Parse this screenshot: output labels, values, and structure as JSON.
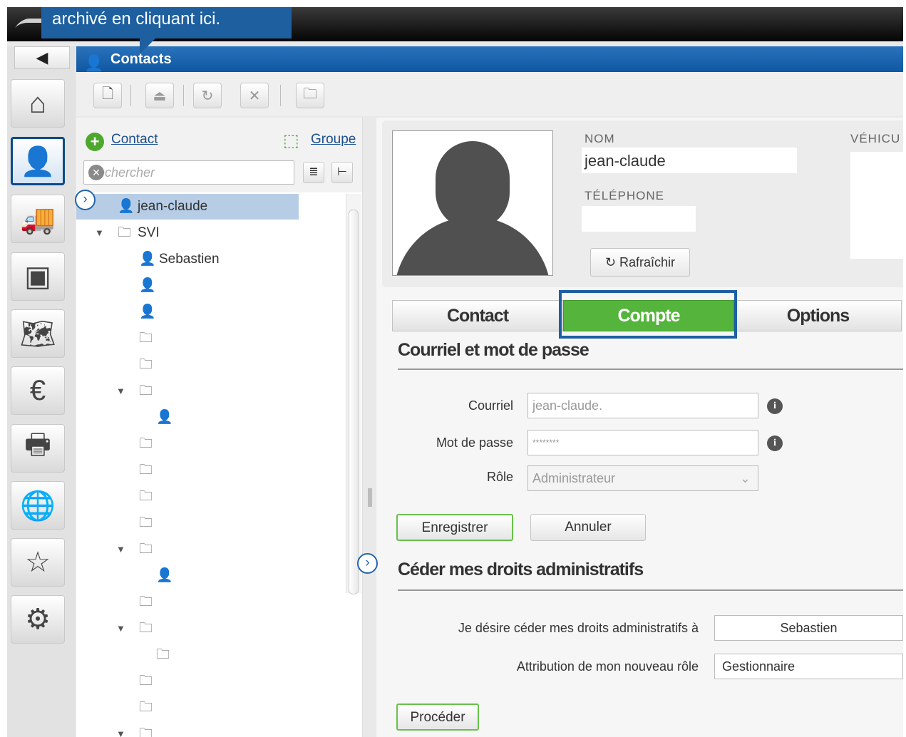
{
  "tooltip": "archivé en cliquant ici.",
  "header": {
    "title": "Contacts"
  },
  "colors": {
    "accent": "#0f57a2",
    "green": "#55b43c",
    "highlight": "#1c5fa3"
  },
  "nav_icons": [
    "home-icon",
    "contact-person-icon",
    "vehicles-icon",
    "device-icon",
    "map-icon",
    "billing-icon",
    "printer-icon",
    "globe-icon",
    "star-icon",
    "gear-icon"
  ],
  "left": {
    "add_contact": "Contact",
    "add_group": "Groupe",
    "search_placeholder": "Rechercher",
    "tree": [
      {
        "type": "person",
        "label": "jean-claude",
        "indent": 0,
        "selected": true,
        "expand": false
      },
      {
        "type": "folder",
        "label": "SVI",
        "indent": 0,
        "expand": true
      },
      {
        "type": "person",
        "label": "Sebastien",
        "indent": 1,
        "expand": false
      },
      {
        "type": "person",
        "label": "",
        "indent": 1,
        "expand": false
      },
      {
        "type": "person",
        "label": "",
        "indent": 1,
        "expand": false
      },
      {
        "type": "folder",
        "label": "",
        "indent": 1,
        "expand": false
      },
      {
        "type": "folder",
        "label": "",
        "indent": 1,
        "expand": false
      },
      {
        "type": "folder",
        "label": "",
        "indent": 1,
        "expand": true
      },
      {
        "type": "person",
        "label": "",
        "indent": 2,
        "expand": false
      },
      {
        "type": "folder",
        "label": "",
        "indent": 1,
        "expand": false
      },
      {
        "type": "folder",
        "label": "",
        "indent": 1,
        "expand": false
      },
      {
        "type": "folder",
        "label": "",
        "indent": 1,
        "expand": false
      },
      {
        "type": "folder",
        "label": "",
        "indent": 1,
        "expand": false
      },
      {
        "type": "folder",
        "label": "",
        "indent": 1,
        "expand": true
      },
      {
        "type": "person",
        "label": "",
        "indent": 2,
        "expand": false
      },
      {
        "type": "folder",
        "label": "",
        "indent": 1,
        "expand": false
      },
      {
        "type": "folder",
        "label": "",
        "indent": 1,
        "expand": true
      },
      {
        "type": "folder",
        "label": "",
        "indent": 2,
        "expand": false
      },
      {
        "type": "folder",
        "label": "",
        "indent": 1,
        "expand": false
      },
      {
        "type": "folder",
        "label": "",
        "indent": 1,
        "expand": false
      },
      {
        "type": "folder",
        "label": "",
        "indent": 1,
        "expand": true
      }
    ]
  },
  "profile": {
    "nom_label": "NOM",
    "nom_value": "jean-claude",
    "tel_label": "TÉLÉPHONE",
    "vehicule_label": "VÉHICU",
    "refresh": "Rafraîchir"
  },
  "tabs": [
    "Contact",
    "Compte",
    "Options"
  ],
  "account": {
    "section1": "Courriel et mot de passe",
    "email_label": "Courriel",
    "email_value": "jean-claude.",
    "password_label": "Mot de passe",
    "password_value": "********",
    "role_label": "Rôle",
    "role_value": "Administrateur",
    "save": "Enregistrer",
    "cancel": "Annuler",
    "section2": "Céder mes droits administratifs",
    "transfer_label": "Je désire céder mes droits administratifs à",
    "transfer_value": "Sebastien",
    "newrole_label": "Attribution de mon nouveau rôle",
    "newrole_value": "Gestionnaire",
    "proceed": "Procéder"
  }
}
